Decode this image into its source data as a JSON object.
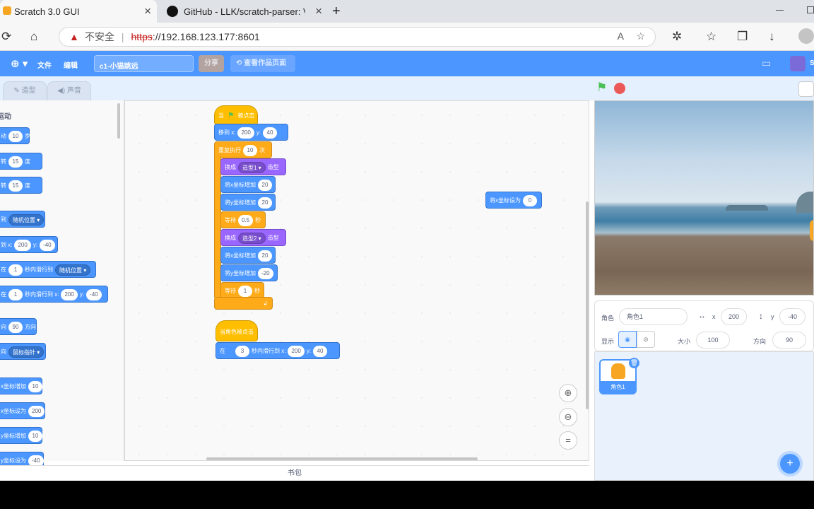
{
  "browser": {
    "tabs": [
      {
        "title": "Scratch 3.0 GUI",
        "active": true
      },
      {
        "title": "GitHub - LLK/scratch-parser: Vali",
        "active": false
      }
    ],
    "security_label": "不安全",
    "url_scheme": "https",
    "url_rest": "://192.168.123.177:8601"
  },
  "menubar": {
    "file": "文件",
    "edit": "编辑",
    "project_title": "c1-小猫跳远",
    "share": "分享",
    "see_project": "查看作品页面",
    "user_fragment": "S"
  },
  "editor_tabs": {
    "costumes": "造型",
    "sounds": "声音"
  },
  "palette": {
    "category": "运动",
    "blocks": [
      {
        "label": "动",
        "inputs": [
          "10",
          "步"
        ]
      },
      {
        "label": "转",
        "inputs": [
          "15",
          "度"
        ]
      },
      {
        "label": "转",
        "inputs": [
          "15",
          "度"
        ]
      },
      {
        "label": "到",
        "dropdown": "随机位置"
      },
      {
        "label": "到 x:",
        "inputs": [
          "200",
          "y:",
          "-40"
        ]
      },
      {
        "label": "在",
        "inputs": [
          "1",
          "秒内滑行到"
        ],
        "dropdown": "随机位置"
      },
      {
        "label": "在",
        "inputs": [
          "1",
          "秒内滑行到 x:",
          "200",
          "y:",
          "-40"
        ]
      },
      {
        "label": "向",
        "inputs": [
          "90",
          "方向"
        ]
      },
      {
        "label": "向",
        "dropdown": "鼠标指针"
      },
      {
        "label": "x坐标增加",
        "inputs": [
          "10"
        ]
      },
      {
        "label": "x坐标设为",
        "inputs": [
          "200"
        ]
      },
      {
        "label": "y坐标增加",
        "inputs": [
          "10"
        ]
      },
      {
        "label": "y坐标设为",
        "inputs": [
          "-40"
        ]
      }
    ]
  },
  "script1": {
    "hat": "当",
    "hat_suffix": "被点击",
    "goto_label": "移到 x:",
    "goto_x": "200",
    "goto_y_label": "y:",
    "goto_y": "40",
    "repeat_label": "重复执行",
    "repeat_times": "10",
    "repeat_suffix": "次",
    "switch_label": "换成",
    "costume1": "造型1",
    "costume_suffix": "造型",
    "changex_label": "将x坐标增加",
    "changex1": "20",
    "changey_label": "将y坐标增加",
    "changey1": "20",
    "wait_label": "等待",
    "wait1": "0.5",
    "wait_suffix": "秒",
    "costume2": "造型2",
    "changex2": "20",
    "changey2": "-20",
    "wait2": "1"
  },
  "script2": {
    "hat": "当角色被点击",
    "glide_label": "在",
    "glide_secs": "3",
    "glide_mid": "秒内滑行到 x:",
    "glide_x": "200",
    "glide_y_label": "y:",
    "glide_y": "40"
  },
  "loose_block": {
    "label": "将x坐标设为",
    "value": "0"
  },
  "sprite_info": {
    "sprite_label": "角色",
    "sprite_name": "角色1",
    "x_label": "x",
    "x": "200",
    "y_label": "y",
    "y": "-40",
    "show_label": "显示",
    "size_label": "大小",
    "size": "100",
    "direction_label": "方向",
    "direction": "90"
  },
  "sprite_list": [
    {
      "name": "角色1"
    }
  ],
  "backpack": "书包",
  "colors": {
    "scratch_blue": "#4c97ff",
    "motion": "#4c97ff",
    "looks": "#9966ff",
    "control": "#ffab19",
    "events": "#ffbf00",
    "green_flag": "#4cbf56",
    "stop": "#ec5959"
  }
}
